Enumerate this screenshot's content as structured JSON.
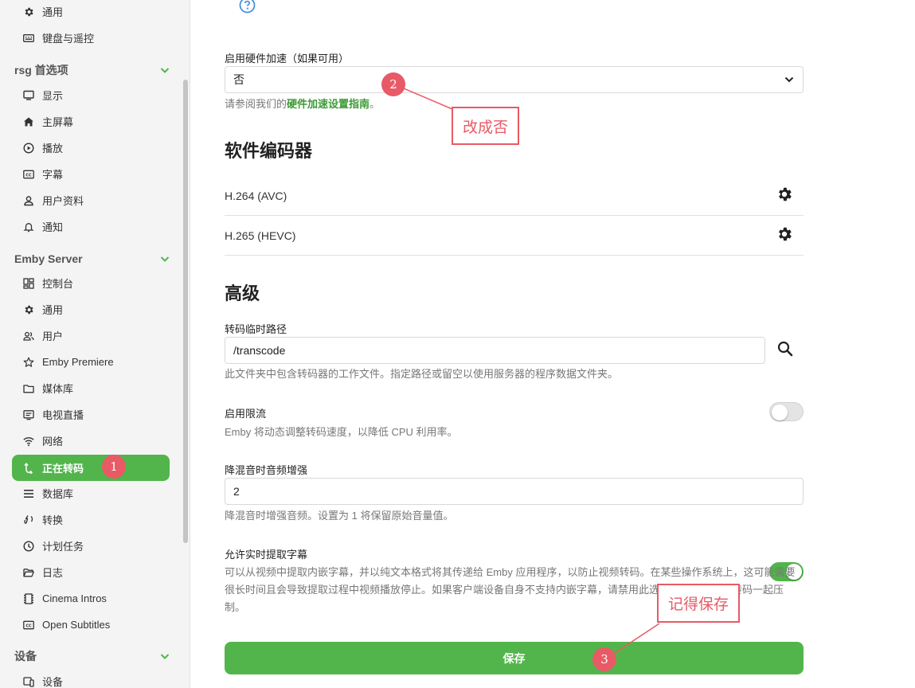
{
  "sidebar": {
    "top_items": [
      {
        "label": "通用",
        "icon": "gear-icon"
      },
      {
        "label": "键盘与遥控",
        "icon": "keyboard-icon"
      }
    ],
    "sections": [
      {
        "title": "rsg 首选项",
        "items": [
          {
            "label": "显示",
            "icon": "monitor-icon"
          },
          {
            "label": "主屏幕",
            "icon": "home-icon"
          },
          {
            "label": "播放",
            "icon": "play-circle-icon"
          },
          {
            "label": "字幕",
            "icon": "cc-icon"
          },
          {
            "label": "用户资料",
            "icon": "person-icon"
          },
          {
            "label": "通知",
            "icon": "bell-icon"
          }
        ]
      },
      {
        "title": "Emby Server",
        "items": [
          {
            "label": "控制台",
            "icon": "dashboard-icon"
          },
          {
            "label": "通用",
            "icon": "gear-icon"
          },
          {
            "label": "用户",
            "icon": "people-icon"
          },
          {
            "label": "Emby Premiere",
            "icon": "star-icon"
          },
          {
            "label": "媒体库",
            "icon": "folder-icon"
          },
          {
            "label": "电视直播",
            "icon": "tv-icon"
          },
          {
            "label": "网络",
            "icon": "wifi-icon"
          },
          {
            "label": "正在转码",
            "icon": "transcode-icon",
            "active": true
          },
          {
            "label": "数据库",
            "icon": "list-icon"
          },
          {
            "label": "转换",
            "icon": "sync-icon"
          },
          {
            "label": "计划任务",
            "icon": "clock-icon"
          },
          {
            "label": "日志",
            "icon": "folder-open-icon"
          },
          {
            "label": "Cinema Intros",
            "icon": "film-icon"
          },
          {
            "label": "Open Subtitles",
            "icon": "cc-icon"
          }
        ]
      },
      {
        "title": "设备",
        "items": [
          {
            "label": "设备",
            "icon": "devices-icon"
          }
        ]
      }
    ]
  },
  "main": {
    "hw_accel": {
      "label": "启用硬件加速（如果可用）",
      "value": "否",
      "help_prefix": "请参阅我们的",
      "help_link": "硬件加速设置指南",
      "help_suffix": "。"
    },
    "software_encoders": {
      "title": "软件编码器",
      "codecs": [
        "H.264 (AVC)",
        "H.265 (HEVC)"
      ]
    },
    "advanced": {
      "title": "高级",
      "temp_path": {
        "label": "转码临时路径",
        "value": "/transcode",
        "help": "此文件夹中包含转码器的工作文件。指定路径或留空以使用服务器的程序数据文件夹。"
      },
      "throttle": {
        "label": "启用限流",
        "help": "Emby 将动态调整转码速度，以降低 CPU 利用率。",
        "enabled": false
      },
      "downmix": {
        "label": "降混音时音频增强",
        "value": "2",
        "help": "降混音时增强音频。设置为 1 将保留原始音量值。"
      },
      "subtitle_extract": {
        "label": "允许实时提取字幕",
        "help": "可以从视频中提取内嵌字幕，并以纯文本格式将其传递给 Emby 应用程序，以防止视频转码。在某些操作系统上，这可能需要很长时间且会导致提取过程中视频播放停止。如果客户端设备自身不支持内嵌字幕，请禁用此选项以将其与视频转码一起压制。",
        "enabled": true
      }
    },
    "save_label": "保存"
  },
  "annotations": {
    "badge1": "1",
    "badge2": "2",
    "badge3": "3",
    "callout2": "改成否",
    "callout3": "记得保存",
    "color": "#e85a66"
  },
  "colors": {
    "accent": "#52b54b",
    "link": "#3d9a36"
  }
}
